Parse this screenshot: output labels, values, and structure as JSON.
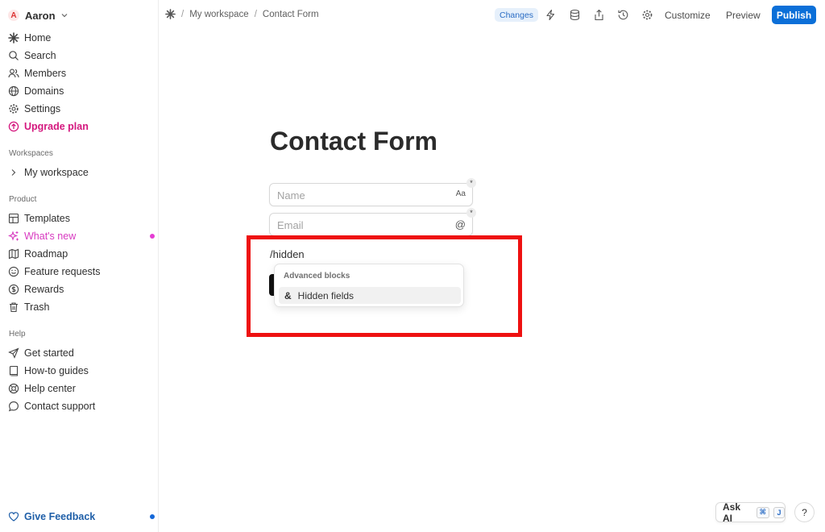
{
  "user": {
    "initial": "A",
    "name": "Aaron"
  },
  "sidebar": {
    "main": [
      {
        "label": "Home",
        "icon": "home-icon"
      },
      {
        "label": "Search",
        "icon": "search-icon"
      },
      {
        "label": "Members",
        "icon": "members-icon"
      },
      {
        "label": "Domains",
        "icon": "globe-icon"
      },
      {
        "label": "Settings",
        "icon": "gear-icon"
      },
      {
        "label": "Upgrade plan",
        "icon": "upgrade-icon"
      }
    ],
    "workspaces_label": "Workspaces",
    "workspace_item": "My workspace",
    "product_label": "Product",
    "product": [
      {
        "label": "Templates",
        "icon": "templates-icon"
      },
      {
        "label": "What's new",
        "icon": "sparkle-icon"
      },
      {
        "label": "Roadmap",
        "icon": "map-icon"
      },
      {
        "label": "Feature requests",
        "icon": "smile-icon"
      },
      {
        "label": "Rewards",
        "icon": "dollar-icon"
      },
      {
        "label": "Trash",
        "icon": "trash-icon"
      }
    ],
    "help_label": "Help",
    "help": [
      {
        "label": "Get started",
        "icon": "send-icon"
      },
      {
        "label": "How-to guides",
        "icon": "book-icon"
      },
      {
        "label": "Help center",
        "icon": "lifebuoy-icon"
      },
      {
        "label": "Contact support",
        "icon": "chat-icon"
      }
    ],
    "feedback": "Give Feedback"
  },
  "topbar": {
    "breadcrumb": [
      "My workspace",
      "Contact Form"
    ],
    "changes": "Changes",
    "customize": "Customize",
    "preview": "Preview",
    "publish": "Publish"
  },
  "form": {
    "title": "Contact Form",
    "name_placeholder": "Name",
    "name_icon": "Aa",
    "email_placeholder": "Email",
    "email_icon": "@",
    "required_mark": "*",
    "command_text": "/hidden"
  },
  "popup": {
    "section": "Advanced blocks",
    "item_icon": "&",
    "item_label": "Hidden fields"
  },
  "bottom": {
    "ask_ai": "Ask AI",
    "kbd1": "⌘",
    "kbd2": "J",
    "help": "?"
  },
  "colors": {
    "accent": "#0b6fd8",
    "upgrade": "#d4177e",
    "whats_new": "#d83ac0",
    "feedback": "#1f5fa8",
    "highlight": "#ee1111"
  }
}
